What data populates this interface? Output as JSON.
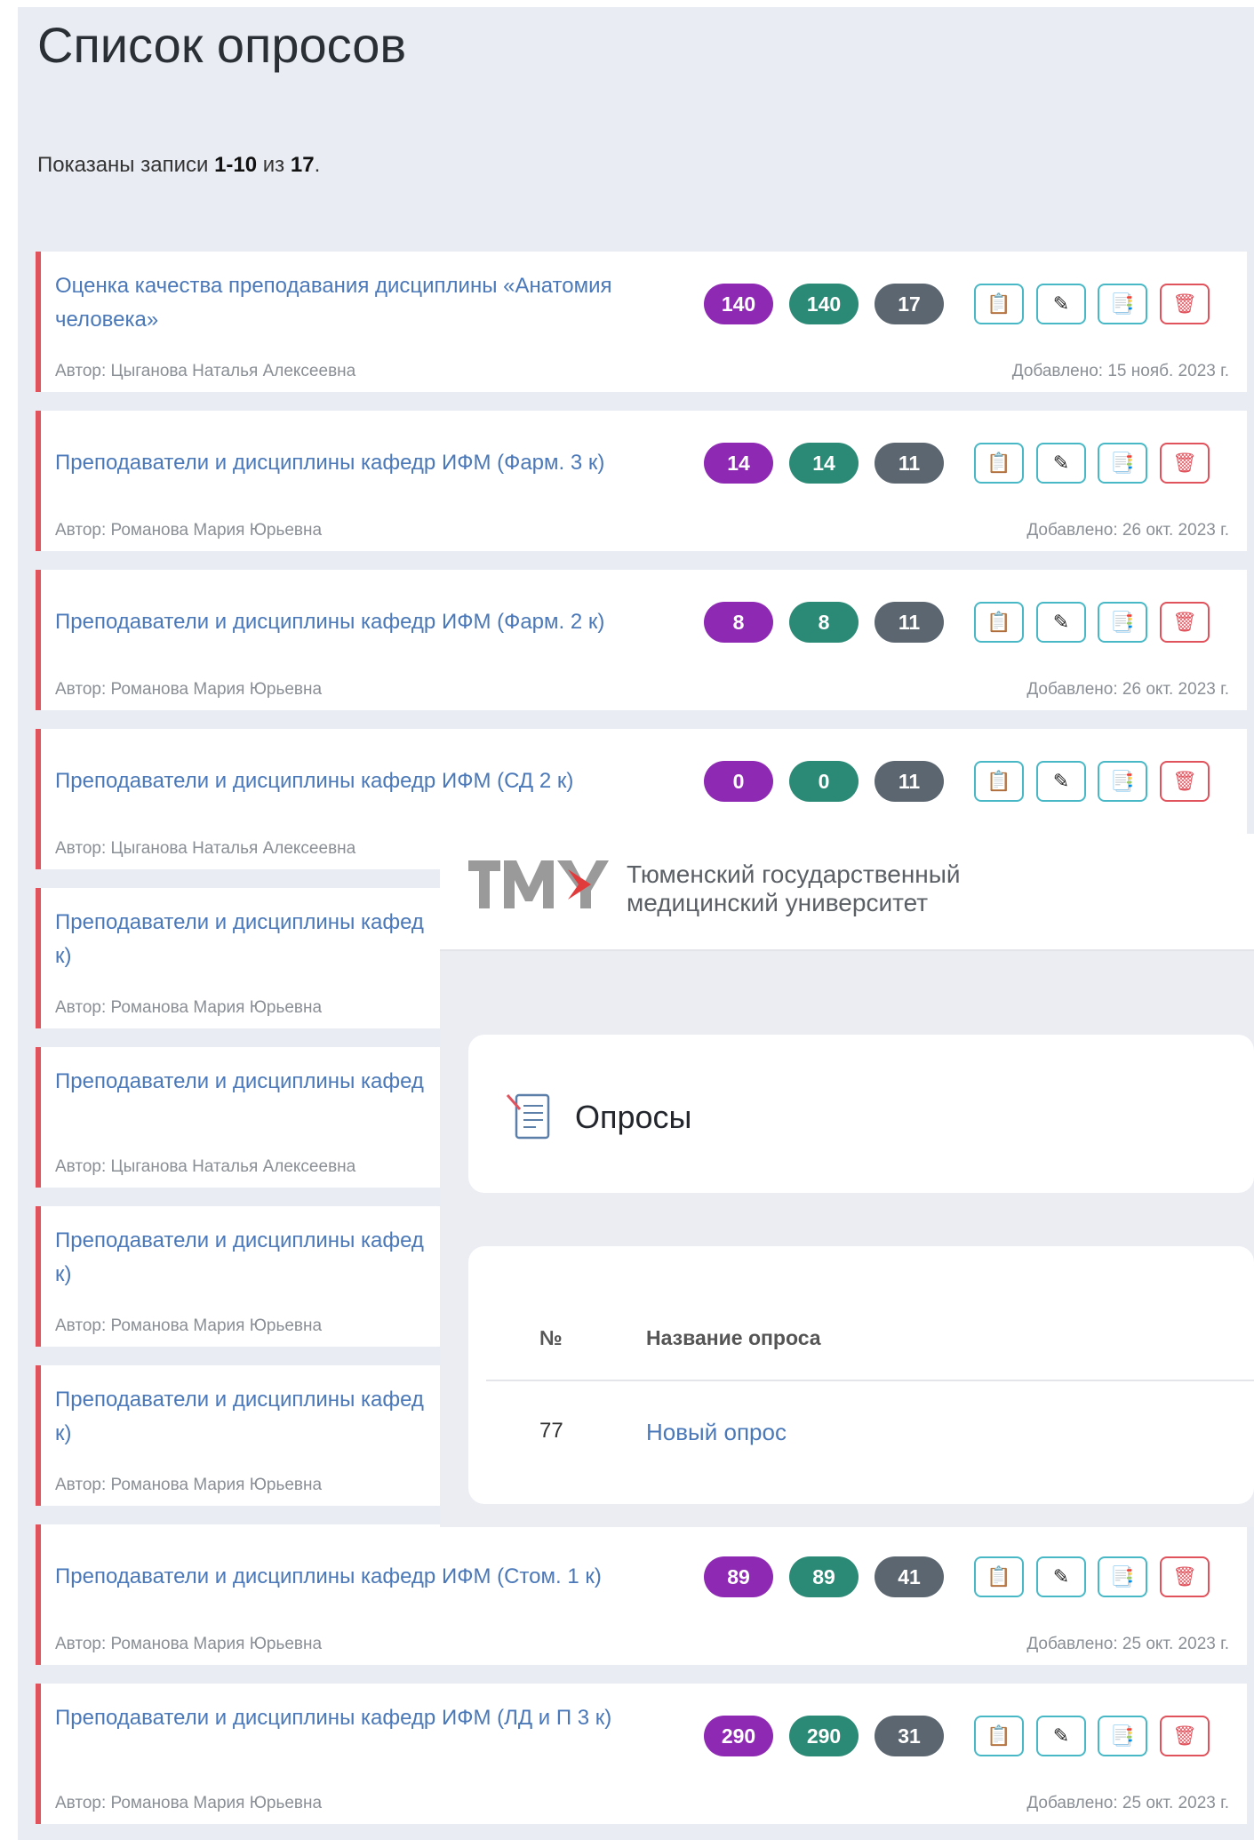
{
  "page": {
    "title": "Список опросов",
    "summary_prefix": "Показаны записи ",
    "summary_range": "1-10",
    "summary_mid": " из ",
    "summary_total": "17",
    "summary_suffix": "."
  },
  "surveys": [
    {
      "title": "Оценка качества преподавания дисциплины «Анатомия человека»",
      "author": "Автор: Цыганова Наталья Алексеевна",
      "badges": [
        "140",
        "140",
        "17"
      ],
      "date": "Добавлено: 15 нояб. 2023 г."
    },
    {
      "title": "Преподаватели и дисциплины кафедр ИФМ (Фарм. 3 к)",
      "author": "Автор: Романова Мария Юрьевна",
      "badges": [
        "14",
        "14",
        "11"
      ],
      "date": "Добавлено: 26 окт. 2023 г."
    },
    {
      "title": "Преподаватели и дисциплины кафедр ИФМ (Фарм. 2 к)",
      "author": "Автор: Романова Мария Юрьевна",
      "badges": [
        "8",
        "8",
        "11"
      ],
      "date": "Добавлено: 26 окт. 2023 г."
    },
    {
      "title": "Преподаватели и дисциплины кафедр ИФМ (СД 2 к)",
      "author": "Автор: Цыганова Наталья Алексеевна",
      "badges": [
        "0",
        "0",
        "11"
      ],
      "date": ""
    },
    {
      "title": "Преподаватели и дисциплины кафед",
      "title_tail": "к)",
      "author": "Автор: Романова Мария Юрьевна",
      "badges": [],
      "date": ""
    },
    {
      "title": "Преподаватели и дисциплины кафед",
      "author": "Автор: Цыганова Наталья Алексеевна",
      "badges": [],
      "date": ""
    },
    {
      "title": "Преподаватели и дисциплины кафед",
      "title_tail": "к)",
      "author": "Автор: Романова Мария Юрьевна",
      "badges": [],
      "date": ""
    },
    {
      "title": "Преподаватели и дисциплины кафед",
      "title_tail": "к)",
      "author": "Автор: Романова Мария Юрьевна",
      "badges": [],
      "date": ""
    },
    {
      "title": "Преподаватели и дисциплины кафедр ИФМ (Стом. 1 к)",
      "author": "Автор: Романова Мария Юрьевна",
      "badges": [
        "89",
        "89",
        "41"
      ],
      "date": "Добавлено: 25 окт. 2023 г."
    },
    {
      "title": "Преподаватели и дисциплины кафедр ИФМ (ЛД и П 3 к)",
      "author": "Автор: Романова Мария Юрьевна",
      "badges": [
        "290",
        "290",
        "31"
      ],
      "date": "Добавлено: 25 окт. 2023 г."
    }
  ],
  "actions": {
    "icons": [
      "clipboard-icon",
      "pencil-icon",
      "clipboard-user-icon",
      "trash-icon"
    ],
    "glyphs": [
      "📋",
      "✎",
      "📑",
      "🗑"
    ]
  },
  "overlay": {
    "logo_text": "ТМУ",
    "university_line1": "Тюменский государственный",
    "university_line2": "медицинский университет",
    "section_title": "Опросы",
    "table": {
      "col_num": "№",
      "col_name": "Название опроса",
      "rows": [
        {
          "num": "77",
          "name": "Новый опрос"
        }
      ]
    }
  },
  "colors": {
    "accent_border": "#e0525c",
    "badge_purple": "#8e29b4",
    "badge_green": "#2b8a75",
    "badge_gray": "#5b6670",
    "action_border": "#49b8c6",
    "link": "#4a78b8"
  }
}
